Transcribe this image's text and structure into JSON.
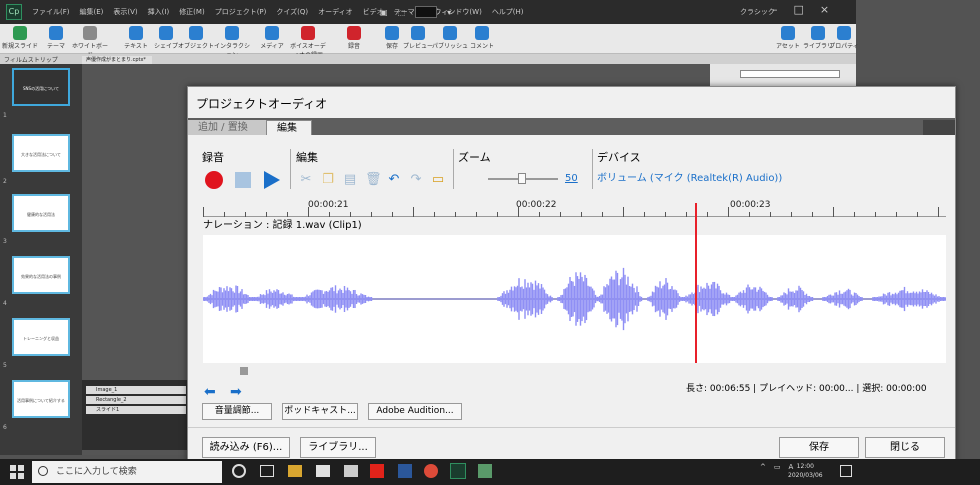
{
  "app": {
    "logo": "Cp",
    "menu": [
      "ファイル(F)",
      "編集(E)",
      "表示(V)",
      "挿入(I)",
      "修正(M)",
      "プロジェクト(P)",
      "クイズ(Q)",
      "オーディオ",
      "ビデオ",
      "テーマ(T)",
      "ウィンドウ(W)",
      "ヘルプ(H)"
    ],
    "zoom_value": "",
    "workspace": "クラシック",
    "toolbar": [
      "新規スライド",
      "テーマ",
      "ホワイトボード",
      "テキスト",
      "シェイプ",
      "オブジェクト",
      "インタラクション",
      "メディア",
      "ボイスオーディオの録画",
      "録音",
      "保存",
      "プレビュー",
      "パブリッシュ",
      "コメント",
      "アセット",
      "ライブラリ",
      "プロパティ"
    ],
    "prop_tabs": [
      "フィルムストリップ"
    ],
    "doc_tab": "声優作成がまとまり.cptx*",
    "timeline_rows": [
      "Image_1",
      "Rectangle_2",
      "スライド1"
    ],
    "slides": [
      {
        "num": "1",
        "text": "SNSの活用について"
      },
      {
        "num": "2",
        "text": "大きな活用法について"
      },
      {
        "num": "3",
        "text": "健康的な活用法"
      },
      {
        "num": "4",
        "text": "効果的な活用法の事例"
      },
      {
        "num": "5",
        "text": "トレーニングと収益"
      },
      {
        "num": "6",
        "text": "活用事例について紹介する"
      }
    ]
  },
  "dialog": {
    "title": "プロジェクトオーディオ",
    "tabs": [
      "追加 / 置換",
      "編集"
    ],
    "sections": {
      "record": "録音",
      "edit": "編集",
      "zoom": "ズーム",
      "device": "デバイス"
    },
    "zoom_value": "50",
    "device_text": "ボリューム (マイク (Realtek(R) Audio))",
    "ruler_labels": [
      "00:00:21",
      "00:00:22",
      "00:00:23"
    ],
    "clip_name": "ナレーション : 記録 1.wav (Clip1)",
    "status": "長さ: 00:06:55 | プレイヘッド: 00:00... | 選択: 00:00:00",
    "buttons": {
      "volume": "音量調節...",
      "podcast": "ポッドキャスト...",
      "audition": "Adobe Audition...",
      "import": "読み込み (F6)...",
      "library": "ライブラリ...",
      "save": "保存",
      "close": "閉じる"
    }
  },
  "taskbar": {
    "search_placeholder": "ここに入力して検索",
    "time": "12:00",
    "date": "2020/03/06",
    "ime": "A"
  },
  "colors": {
    "record": "#e0141e",
    "accent": "#1a6fc9",
    "waveform": "#8f8ff5",
    "playhead": "#e8202a"
  }
}
